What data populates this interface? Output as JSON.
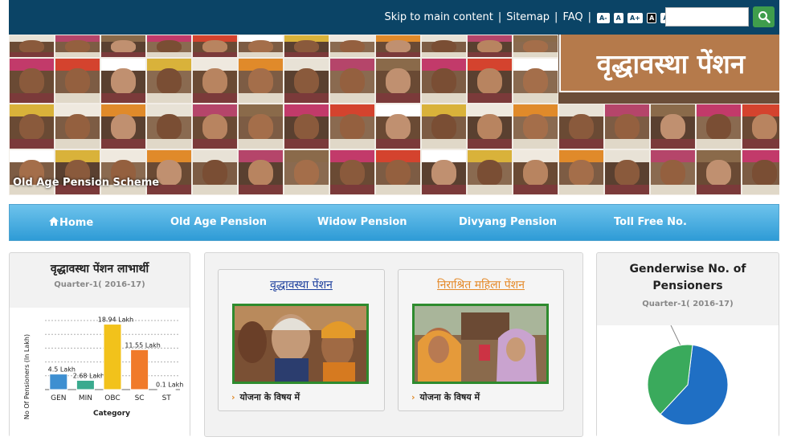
{
  "header": {
    "skip_link": "Skip to main content",
    "sitemap": "Sitemap",
    "faq": "FAQ",
    "font_buttons": [
      "A-",
      "A",
      "A+",
      "A",
      "A"
    ],
    "search_placeholder": ""
  },
  "banner": {
    "title": "वृद्धावस्था पेंशन",
    "caption": "Old Age Pension Scheme"
  },
  "nav": {
    "items": [
      "Home",
      "Old Age Pension",
      "Widow Pension",
      "Divyang Pension",
      "Toll Free No."
    ]
  },
  "beneficiaries_card": {
    "title": "वृद्धावस्था पेंशन लाभार्थी",
    "quarter": "Quarter-1( 2016-17)"
  },
  "schemes": [
    {
      "title": "वृद्धावस्था पेंशन",
      "about": "योजना के विषय में",
      "color": "#1a3d9c"
    },
    {
      "title": "निराश्रित महिला पेंशन",
      "about": "योजना के विषय में",
      "color": "#e58a2a"
    }
  ],
  "gender_card": {
    "title": "Genderwise No. of Pensioners",
    "quarter": "Quarter-1( 2016-17)"
  },
  "chart_data": [
    {
      "type": "bar",
      "categories": [
        "GEN",
        "MIN",
        "OBC",
        "SC",
        "ST"
      ],
      "values": [
        4.5,
        2.68,
        18.94,
        11.55,
        0.1
      ],
      "data_labels": [
        "4.5 Lakh",
        "2.68 Lakh",
        "18.94 Lakh",
        "11.55 Lakh",
        "0.1 Lakh"
      ],
      "colors": [
        "#3d8fd1",
        "#3aaa8e",
        "#f2c21b",
        "#f07a2a",
        "#6aa6d8"
      ],
      "xlabel": "Category",
      "ylabel": "No Of Pensioners (In Lakh)",
      "ylim": [
        0,
        20
      ],
      "grid": true
    },
    {
      "type": "pie",
      "categories": [
        "",
        ""
      ],
      "values": [
        0.6,
        0.4
      ],
      "colors": [
        "#1f6fc4",
        "#3aaa5c"
      ]
    }
  ],
  "colors": {
    "topbar": "#0b4466",
    "nav_gradient_top": "#6ec3ec",
    "nav_gradient_bottom": "#2e9bd6",
    "title_panel": "#b57a4b",
    "search_button": "#3f9d4c"
  }
}
